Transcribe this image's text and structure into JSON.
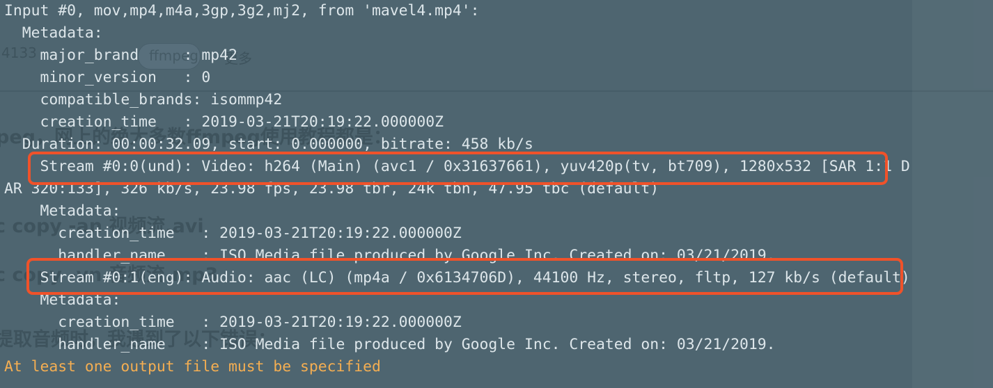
{
  "terminal": {
    "lines": [
      "Input #0, mov,mp4,m4a,3gp,3g2,mj2, from 'mavel4.mp4':",
      "  Metadata:",
      "    major_brand     : mp42",
      "    minor_version   : 0",
      "    compatible_brands: isommp42",
      "    creation_time   : 2019-03-21T20:19:22.000000Z",
      "  Duration: 00:00:32.09, start: 0.000000, bitrate: 458 kb/s",
      "    Stream #0:0(und): Video: h264 (Main) (avc1 / 0x31637661), yuv420p(tv, bt709), 1280x532 [SAR 1:1 D",
      "AR 320:133], 326 kb/s, 23.98 fps, 23.98 tbr, 24k tbn, 47.95 tbc (default)",
      "    Metadata:",
      "      creation_time   : 2019-03-21T20:19:22.000000Z",
      "      handler_name    : ISO Media file produced by Google Inc. Created on: 03/21/2019.",
      "    Stream #0:1(eng): Audio: aac (LC) (mp4a / 0x6134706D), 44100 Hz, stereo, fltp, 127 kb/s (default)",
      "    Metadata:",
      "      creation_time   : 2019-03-21T20:19:22.000000Z",
      "      handler_name    : ISO Media file produced by Google Inc. Created on: 03/21/2019."
    ],
    "error_line": "At least one output file must be specified"
  },
  "background": {
    "fragments": [
      "4133",
      "ffmpeg",
      "更多",
      "peg，网上的绝大多数ffmpeg使用教程都是：",
      "c copy -an 视频流.avi",
      "c copy -vn 音频流.mp3",
      "提取音频时，我遇到了以下错误："
    ]
  },
  "colors": {
    "background": "#4e6570",
    "text": "#dde6ea",
    "error_text": "#f4ae52",
    "highlight_border": "#f0522a"
  }
}
